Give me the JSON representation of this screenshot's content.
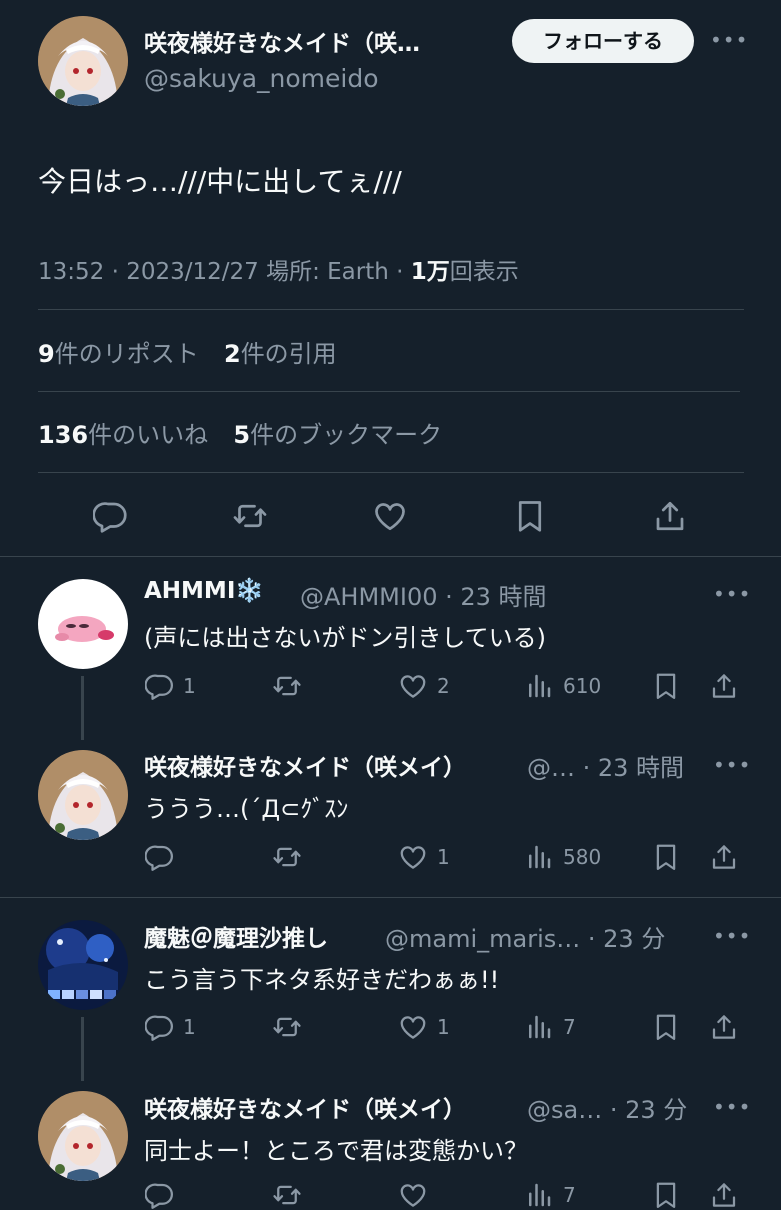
{
  "main_tweet": {
    "display_name": "咲夜様好きなメイド（咲…",
    "handle": "@sakuya_nomeido",
    "follow_label": "フォローする",
    "more_label": "•••",
    "text": "今日はっ…///中に出してぇ///",
    "time": "13:52 · 2023/12/27 場所: Earth · ",
    "views_count": "1万",
    "views_label": "回表示",
    "reposts_count": "9",
    "reposts_label": "件のリポスト",
    "quotes_count": "2",
    "quotes_label": "件の引用",
    "likes_count": "136",
    "likes_label": "件のいいね",
    "bookmarks_count": "5",
    "bookmarks_label": "件のブックマーク"
  },
  "replies": [
    {
      "display_name": "AHMMI❄️",
      "meta": "@AHMMI00 · 23 時間",
      "text": "(声には出さないがドン引きしている)",
      "reply_count": "1",
      "repost_count": "",
      "like_count": "2",
      "view_count": "610",
      "more_label": "•••"
    },
    {
      "display_name": "咲夜様好きなメイド（咲メイ）",
      "meta": "@… · 23 時間",
      "text": "ううう…(´Д⊂ｸﾞｽﾝ",
      "reply_count": "",
      "repost_count": "",
      "like_count": "1",
      "view_count": "580",
      "more_label": "•••"
    },
    {
      "display_name": "魔魅＠魔理沙推し",
      "meta": "@mami_maris… · 23 分",
      "text": "こう言う下ネタ系好きだわぁぁ!!",
      "reply_count": "1",
      "repost_count": "",
      "like_count": "1",
      "view_count": "7",
      "more_label": "•••"
    },
    {
      "display_name": "咲夜様好きなメイド（咲メイ）",
      "meta": "@sa… · 23 分",
      "text": "同士よー！ところで君は変態かい？",
      "reply_count": "",
      "repost_count": "",
      "like_count": "",
      "view_count": "7",
      "more_label": "•••"
    }
  ],
  "icons": [
    "reply-icon",
    "repost-icon",
    "like-icon",
    "bookmark-icon",
    "share-icon",
    "views-icon"
  ],
  "colors": {
    "background": "#15202b",
    "text": "#f7f9f9",
    "muted": "#8b98a5",
    "divider": "#38444d",
    "follow_button": "#eff3f4"
  }
}
